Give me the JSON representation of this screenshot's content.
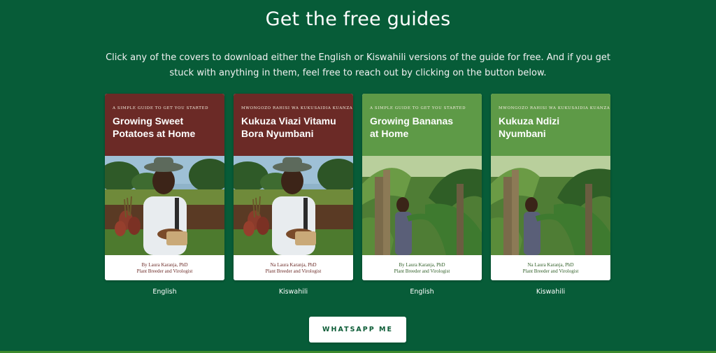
{
  "heading": "Get the free guides",
  "intro": "Click any of the covers to download either the English or Kiswahili versions of the guide for free. And if you get stuck with anything in them, feel free to reach out by clicking on the button below.",
  "colors": {
    "background": "#075c38",
    "brown_band": "#6b2a26",
    "green_band": "#5e9a47",
    "button_text": "#0c5c36"
  },
  "covers": [
    {
      "kicker": "A simple guide to get you started",
      "title_line1": "Growing Sweet",
      "title_line2": "Potatoes at Home",
      "author": "By Laura Karanja, PhD",
      "role": "Plant Breeder and Virologist",
      "language": "English",
      "band": "brown",
      "photo": "farmer-with-sweet-potatoes"
    },
    {
      "kicker": "Mwongozo rahisi wa kukusaidia kuanza",
      "title_line1": "Kukuza Viazi Vitamu",
      "title_line2": "Bora Nyumbani",
      "author": "Na Laura Karanja, PhD",
      "role": "Plant Breeder and Virologist",
      "language": "Kiswahili",
      "band": "brown",
      "photo": "farmer-with-sweet-potatoes"
    },
    {
      "kicker": "A simple guide to get you started",
      "title_line1": "Growing Bananas",
      "title_line2": "at Home",
      "author": "By Laura Karanja, PhD",
      "role": "Plant Breeder and Virologist",
      "language": "English",
      "band": "green",
      "photo": "farmer-among-banana-plants"
    },
    {
      "kicker": "Mwongozo rahisi wa kukusaidia kuanza",
      "title_line1": "Kukuza Ndizi",
      "title_line2": "Nyumbani",
      "author": "Na Laura Karanja, PhD",
      "role": "Plant Breeder and Virologist",
      "language": "Kiswahili",
      "band": "green",
      "photo": "farmer-among-banana-plants"
    }
  ],
  "cta_label": "WHATSAPP ME"
}
